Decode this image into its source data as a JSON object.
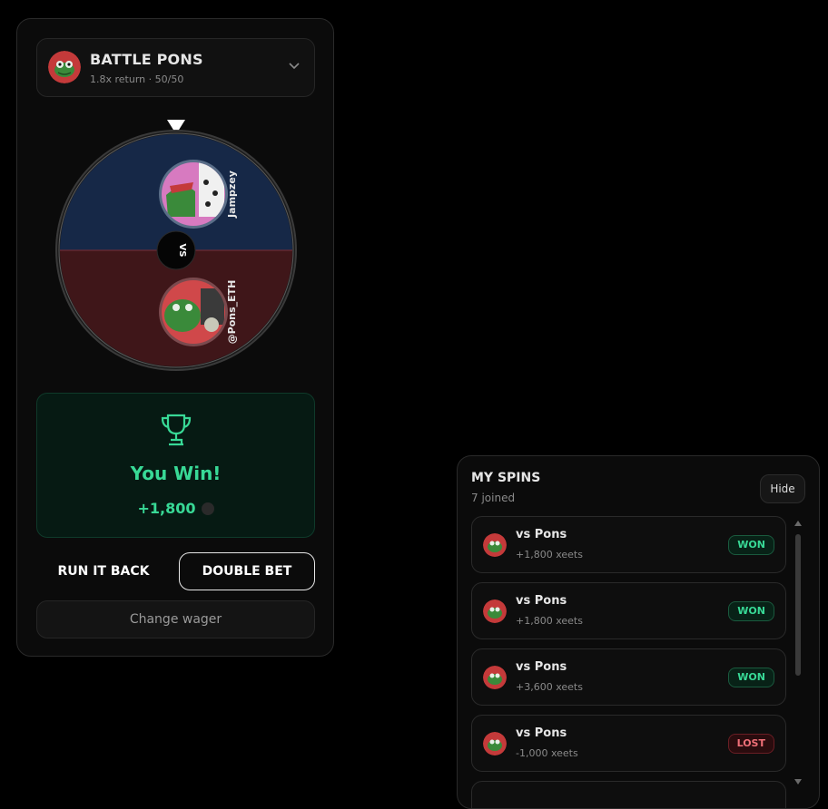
{
  "game": {
    "title": "BATTLE PONS",
    "subtitle": "1.8x return · 50/50",
    "avatar_icon": "frog-avatar-icon",
    "chevron_icon": "chevron-down-icon"
  },
  "wheel": {
    "top_player": "Jampzey",
    "bottom_player": "@Pons_ETH",
    "vs_label": "VS",
    "top_color": "#162847",
    "bottom_color": "#3f1619",
    "pointer_icon": "pointer-triangle-icon"
  },
  "result": {
    "icon": "trophy-icon",
    "title": "You Win!",
    "amount": "+1,800",
    "accent": "#38d996"
  },
  "actions": {
    "run_it_back": "RUN IT BACK",
    "double_bet": "DOUBLE BET",
    "change_wager": "Change wager"
  },
  "spins": {
    "title": "MY SPINS",
    "joined": "7 joined",
    "hide_label": "Hide",
    "items": [
      {
        "opponent": "vs Pons",
        "amount": "+1,800 xeets",
        "status": "WON"
      },
      {
        "opponent": "vs Pons",
        "amount": "+1,800 xeets",
        "status": "WON"
      },
      {
        "opponent": "vs Pons",
        "amount": "+3,600 xeets",
        "status": "WON"
      },
      {
        "opponent": "vs Pons",
        "amount": "-1,000 xeets",
        "status": "LOST"
      }
    ]
  }
}
